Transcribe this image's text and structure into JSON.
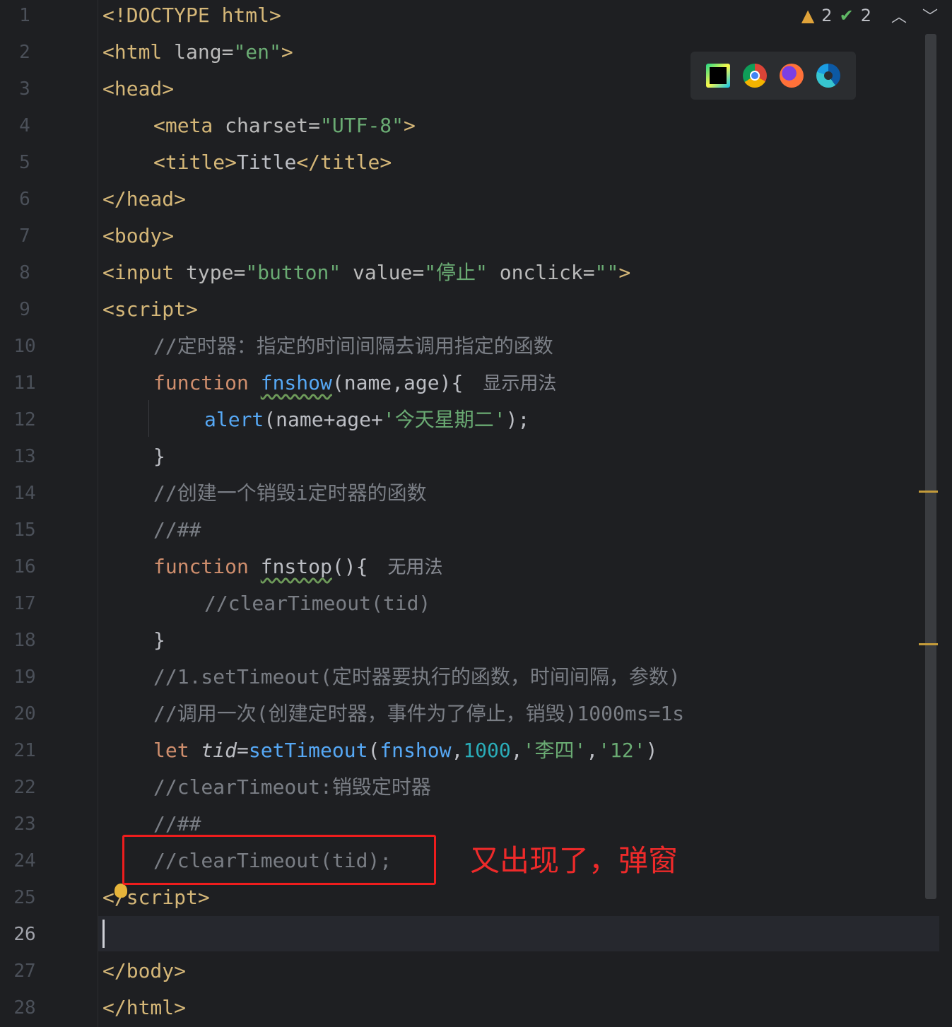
{
  "editor": {
    "line_numbers": [
      "1",
      "2",
      "3",
      "4",
      "5",
      "6",
      "7",
      "8",
      "9",
      "10",
      "11",
      "12",
      "13",
      "14",
      "15",
      "16",
      "17",
      "18",
      "19",
      "20",
      "21",
      "22",
      "23",
      "24",
      "25",
      "26",
      "27",
      "28"
    ],
    "current_line": "26",
    "code": {
      "l1": {
        "lt": "<!DOCTYPE",
        "rest": " html>"
      },
      "l2": {
        "tag": "<html",
        "attr": " lang",
        "eq": "=",
        "val": "\"en\"",
        "end": ">"
      },
      "l3": {
        "tag": "<head>"
      },
      "l4": {
        "tag": "<meta",
        "attr": " charset",
        "eq": "=",
        "val": "\"UTF-8\"",
        "end": ">"
      },
      "l5": {
        "open": "<title>",
        "text": "Title",
        "close": "</title>"
      },
      "l6": {
        "tag": "</head>"
      },
      "l7": {
        "tag": "<body>"
      },
      "l8": {
        "tag": "<input",
        "attr1": " type",
        "eq1": "=",
        "val1": "\"button\"",
        "attr2": " value",
        "eq2": "=",
        "val2": "\"停止\"",
        "attr3": " onclick",
        "eq3": "=",
        "val3": "\"\"",
        "end": ">"
      },
      "l9": {
        "tag": "<script>"
      },
      "l10": {
        "comment": "//定时器：指定的时间间隔去调用指定的函数"
      },
      "l11": {
        "kw": "function ",
        "fn": "fnshow",
        "params": "(name,age){",
        "hint": "显示用法"
      },
      "l12": {
        "fn": "alert",
        "p1": "(name+age+",
        "str": "'今天星期二'",
        "p2": ");"
      },
      "l13": {
        "brace": "}"
      },
      "l14": {
        "comment": "//创建一个销毁i定时器的函数"
      },
      "l15": {
        "comment": "//##"
      },
      "l16": {
        "kw": "function ",
        "fn": "fnstop",
        "params": "(){",
        "hint": "无用法"
      },
      "l17": {
        "comment": "//clearTimeout(tid)"
      },
      "l18": {
        "brace": "}"
      },
      "l19": {
        "comment": "//1.setTimeout(定时器要执行的函数，时间间隔，参数)"
      },
      "l20": {
        "comment": "//调用一次(创建定时器，事件为了停止，销毁)1000ms=1s"
      },
      "l21": {
        "kw": "let ",
        "var": "tid",
        "eq": "=",
        "fn": "setTimeout",
        "p1": "(",
        "arg1": "fnshow",
        "c1": ",",
        "num": "1000",
        "c2": ",",
        "str1": "'李四'",
        "c3": ",",
        "str2": "'12'",
        "p2": ")"
      },
      "l22": {
        "comment": "//clearTimeout:销毁定时器"
      },
      "l23": {
        "comment": "//##"
      },
      "l24": {
        "comment": "//clearTimeout(tid);"
      },
      "l25": {
        "lt": "<",
        "tag": "/script>"
      },
      "l27": {
        "tag": "</body>"
      },
      "l28": {
        "tag": "</html>"
      }
    }
  },
  "inspection": {
    "warnings": "2",
    "checks": "2",
    "up_icon": "chevron-up-icon",
    "down_icon": "chevron-down-icon"
  },
  "browser_bar": {
    "icons": [
      "pycharm-icon",
      "chrome-icon",
      "firefox-icon",
      "edge-icon"
    ]
  },
  "annotation": {
    "text": "又出现了，弹窗",
    "color": "#ee1d1d"
  },
  "colors": {
    "background": "#1e1f22",
    "tag": "#d5b778",
    "string": "#6aab73",
    "keyword": "#cf8e6d",
    "function": "#56a8f5",
    "number": "#2aacb8",
    "comment": "#7a7e85"
  }
}
